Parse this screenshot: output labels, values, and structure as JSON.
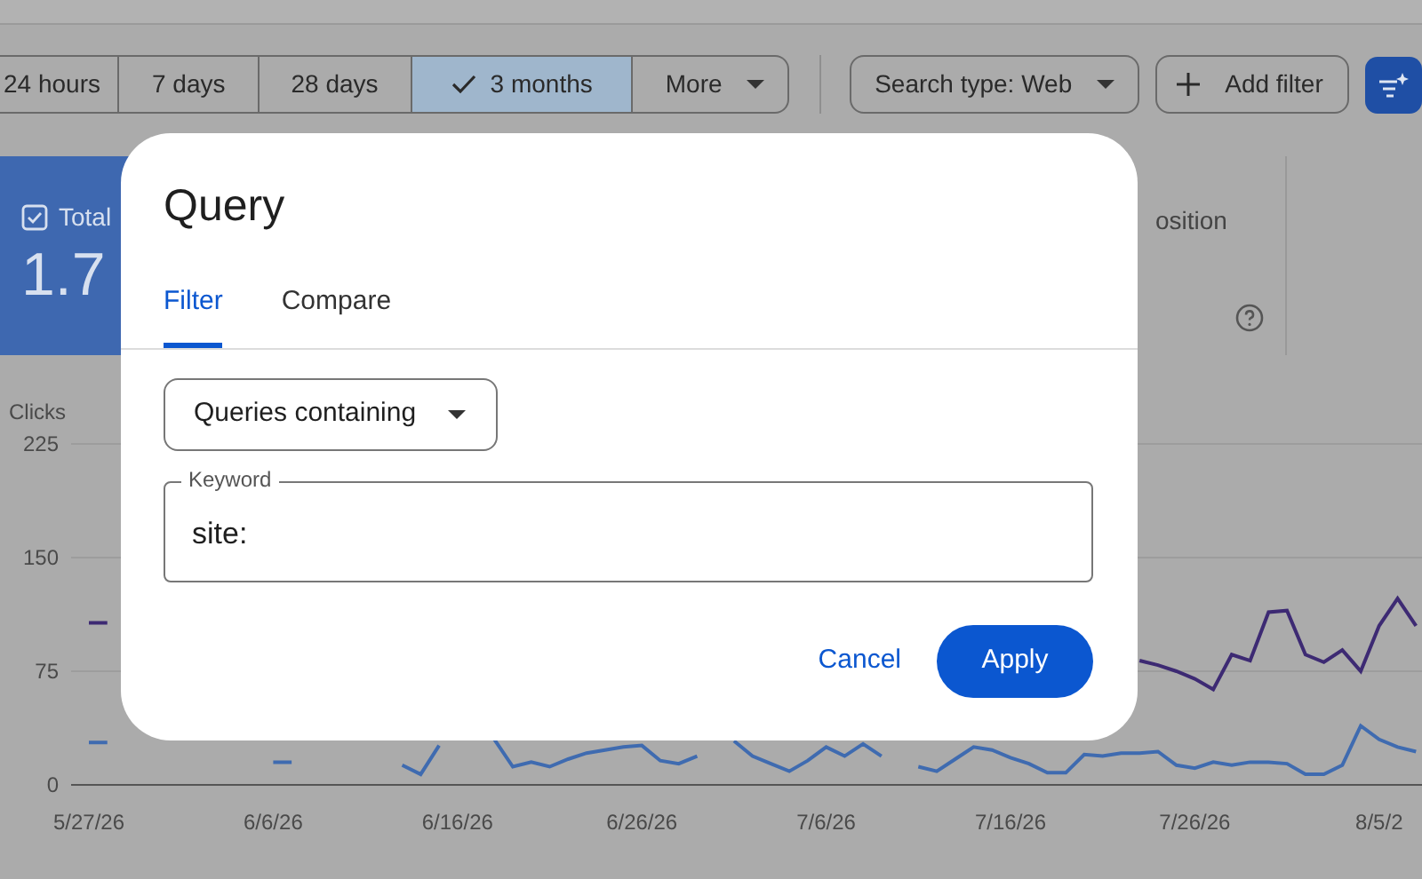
{
  "toolbar": {
    "date_ranges": [
      {
        "label": "24 hours",
        "selected": false
      },
      {
        "label": "7 days",
        "selected": false
      },
      {
        "label": "28 days",
        "selected": false
      },
      {
        "label": "3 months",
        "selected": true
      }
    ],
    "more_menu": {
      "label": "More"
    },
    "search_type": {
      "label": "Search type: Web"
    },
    "add_filter": {
      "label": "Add filter"
    }
  },
  "total_card": {
    "label": "Total",
    "value": "1.7",
    "checked": true
  },
  "position_card": {
    "label": "osition"
  },
  "chart": {
    "chart_data": {
      "type": "line",
      "ylabel": "Clicks",
      "categories": [
        "5/27/26",
        null,
        null,
        null,
        null,
        null,
        null,
        null,
        null,
        null,
        "6/6/26",
        null,
        null,
        null,
        null,
        null,
        null,
        null,
        null,
        null,
        "6/16/26",
        null,
        null,
        null,
        null,
        null,
        null,
        null,
        null,
        null,
        "6/26/26",
        null,
        null,
        null,
        null,
        null,
        null,
        null,
        null,
        null,
        "7/6/26",
        null,
        null,
        null,
        null,
        null,
        null,
        null,
        null,
        null,
        "7/16/26",
        null,
        null,
        null,
        null,
        null,
        null,
        null,
        null,
        null,
        "7/26/26",
        null,
        null,
        null,
        null,
        null,
        null,
        null,
        null,
        null,
        "8/5/2",
        null,
        null
      ],
      "series": [
        {
          "color": "#3d2a73",
          "values": [
            107,
            107,
            null,
            null,
            null,
            null,
            null,
            null,
            null,
            null,
            null,
            null,
            null,
            null,
            null,
            null,
            null,
            null,
            null,
            null,
            null,
            null,
            null,
            null,
            null,
            null,
            null,
            null,
            null,
            null,
            null,
            null,
            null,
            null,
            null,
            null,
            null,
            null,
            null,
            null,
            null,
            null,
            null,
            null,
            null,
            null,
            null,
            null,
            null,
            null,
            null,
            null,
            null,
            null,
            null,
            null,
            null,
            82,
            79,
            75,
            70,
            63,
            86,
            82,
            114,
            115,
            86,
            81,
            89,
            75,
            105,
            123,
            105
          ]
        },
        {
          "color": "#3f6bb0",
          "values": [
            28,
            28,
            null,
            null,
            null,
            null,
            null,
            null,
            null,
            null,
            15,
            15,
            null,
            null,
            null,
            null,
            null,
            13,
            7,
            26,
            null,
            null,
            30,
            12,
            15,
            12,
            17,
            21,
            23,
            25,
            26,
            16,
            14,
            19,
            null,
            29,
            19,
            14,
            9,
            16,
            25,
            19,
            27,
            19,
            null,
            12,
            9,
            17,
            25,
            23,
            18,
            14,
            8,
            8,
            20,
            19,
            21,
            21,
            22,
            13,
            11,
            15,
            13,
            15,
            15,
            14,
            7,
            7,
            13,
            39,
            30,
            25,
            22
          ]
        }
      ],
      "ylim": [
        0,
        225
      ],
      "yticks": [
        0,
        75,
        150,
        225
      ]
    }
  },
  "dialog": {
    "title": "Query",
    "tabs": [
      {
        "label": "Filter",
        "selected": true
      },
      {
        "label": "Compare",
        "selected": false
      }
    ],
    "match_type": {
      "value": "Queries containing"
    },
    "keyword": {
      "label": "Keyword",
      "value": "site:"
    },
    "buttons": [
      {
        "label": "Cancel",
        "kind": "text"
      },
      {
        "label": "Apply",
        "kind": "filled"
      }
    ]
  }
}
